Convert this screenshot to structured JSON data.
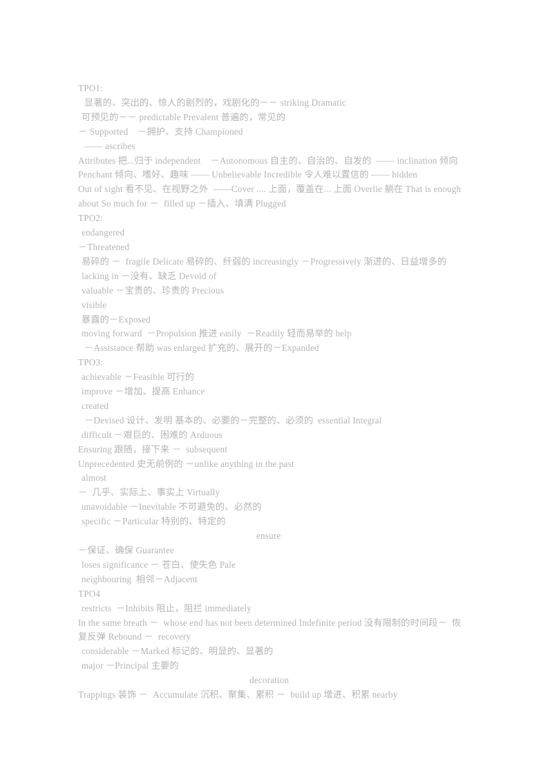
{
  "document": {
    "text_color": "#b4b4b8",
    "background_color": "#ffffff",
    "sections": [
      {
        "heading": "TPO1:",
        "lines": [
          {
            "indent": "ind-0",
            "text": "TPO1:"
          },
          {
            "indent": "ind-2",
            "text": "显著的、突出的、惊人的剧烈的，戏剧化的－－ striking Dramatic"
          },
          {
            "indent": "ind-1",
            "text": "可预见的－－ predictable Prevalent 普遍的，常见的"
          },
          {
            "indent": "ind-0",
            "text": "－ Supported    －拥护、支持 Championed"
          },
          {
            "indent": "ind-2",
            "text": "—— ascribes"
          },
          {
            "indent": "ind-0",
            "text": "Attributes 把...归于 independent    －Autonomous 自主的、自治的、自发的  —— inclination 倾向"
          },
          {
            "indent": "ind-0",
            "text": "Penchant 倾向、嗜好、趣味 —— Unbelievable Incredible 令人难以置信的 —— hidden"
          },
          {
            "indent": "ind-0",
            "text": "Out of sight 看不见、在视野之外  ——Cover .... 上面，覆盖在... 上面 Overlie 躺在 That is enough"
          },
          {
            "indent": "ind-0",
            "text": "about So much for －  filled up －插入、填满 Plugged"
          }
        ]
      },
      {
        "heading": "TPO2:",
        "lines": [
          {
            "indent": "ind-0",
            "text": "TPO2:"
          },
          {
            "indent": "ind-1",
            "text": "endangered"
          },
          {
            "indent": "ind-0",
            "text": "－Threatened"
          },
          {
            "indent": "ind-1",
            "text": "易碎的 －  fragile Delicate 易碎的、纤弱的 increasingly －Progressively 渐进的、日益增多的"
          },
          {
            "indent": "ind-1",
            "text": "lacking in －没有、缺乏 Devoid of"
          },
          {
            "indent": "ind-1",
            "text": "valuable －宝贵的、珍贵的 Precious"
          },
          {
            "indent": "ind-1",
            "text": "visible"
          },
          {
            "indent": "ind-1",
            "text": "暴露的－Exposed"
          },
          {
            "indent": "ind-1",
            "text": "moving forward  －Propulsion 推进 easily  －Readily 轻而易举的 help"
          },
          {
            "indent": "ind-2",
            "text": "－Assistance 帮助 was enlarged 扩充的、展开的－Expanded"
          }
        ]
      },
      {
        "heading": "TPO3:",
        "lines": [
          {
            "indent": "ind-0",
            "text": "TPO3:"
          },
          {
            "indent": "ind-1",
            "text": "achievable －Feasible 可行的"
          },
          {
            "indent": "ind-1",
            "text": "improve －增加、提高 Enhance"
          },
          {
            "indent": "ind-1",
            "text": "created"
          },
          {
            "indent": "ind-2",
            "text": "－Devised 设计、发明 基本的、必要的－完整的、必须的  essential Integral"
          },
          {
            "indent": "ind-1",
            "text": "difficult －艰巨的、困难的 Arduous"
          },
          {
            "indent": "ind-0",
            "text": "Ensuring 跟随，接下来 －  subsequent"
          },
          {
            "indent": "ind-0",
            "text": "Unprecedented 史无前例的 －unlike anything in the past"
          },
          {
            "indent": "ind-1",
            "text": "almost"
          },
          {
            "indent": "ind-0",
            "text": "－  几乎、实际上、事实上 Virtually"
          },
          {
            "indent": "ind-1",
            "text": "unavoidable －Inevitable 不可避免的、必然的"
          },
          {
            "indent": "ind-1",
            "text": "specific －Particular 特别的、特定的"
          },
          {
            "indent": "ind-big",
            "text": "ensure"
          },
          {
            "indent": "ind-0",
            "text": "－保证、确保 Guarantee"
          },
          {
            "indent": "ind-1",
            "text": "loses significance － 苍白、使失色 Pale"
          },
          {
            "indent": "ind-1",
            "text": "neighbouring  相邻－Adjacent"
          }
        ]
      },
      {
        "heading": "TPO4",
        "lines": [
          {
            "indent": "ind-0",
            "text": "TPO4"
          },
          {
            "indent": "ind-1",
            "text": "restricts  －Inhibits 阻止，阻拦 immediately"
          },
          {
            "indent": "ind-0",
            "text": "In the same breath －  whose end has not been determined Indefinite period 没有限制的时间段－  恢"
          },
          {
            "indent": "ind-0",
            "text": "复反弹 Rebound －  recovery"
          },
          {
            "indent": "ind-1",
            "text": "considerable －Marked 标记的、明显的、显著的"
          },
          {
            "indent": "ind-1",
            "text": "major －Principal 主要的"
          },
          {
            "indent": "ind-dec",
            "text": "decoration"
          },
          {
            "indent": "ind-0",
            "text": "Trappings 装饰 －  Accumulate 沉积、聚集、累积 －  build up 增进、积累 nearby"
          }
        ]
      }
    ]
  }
}
